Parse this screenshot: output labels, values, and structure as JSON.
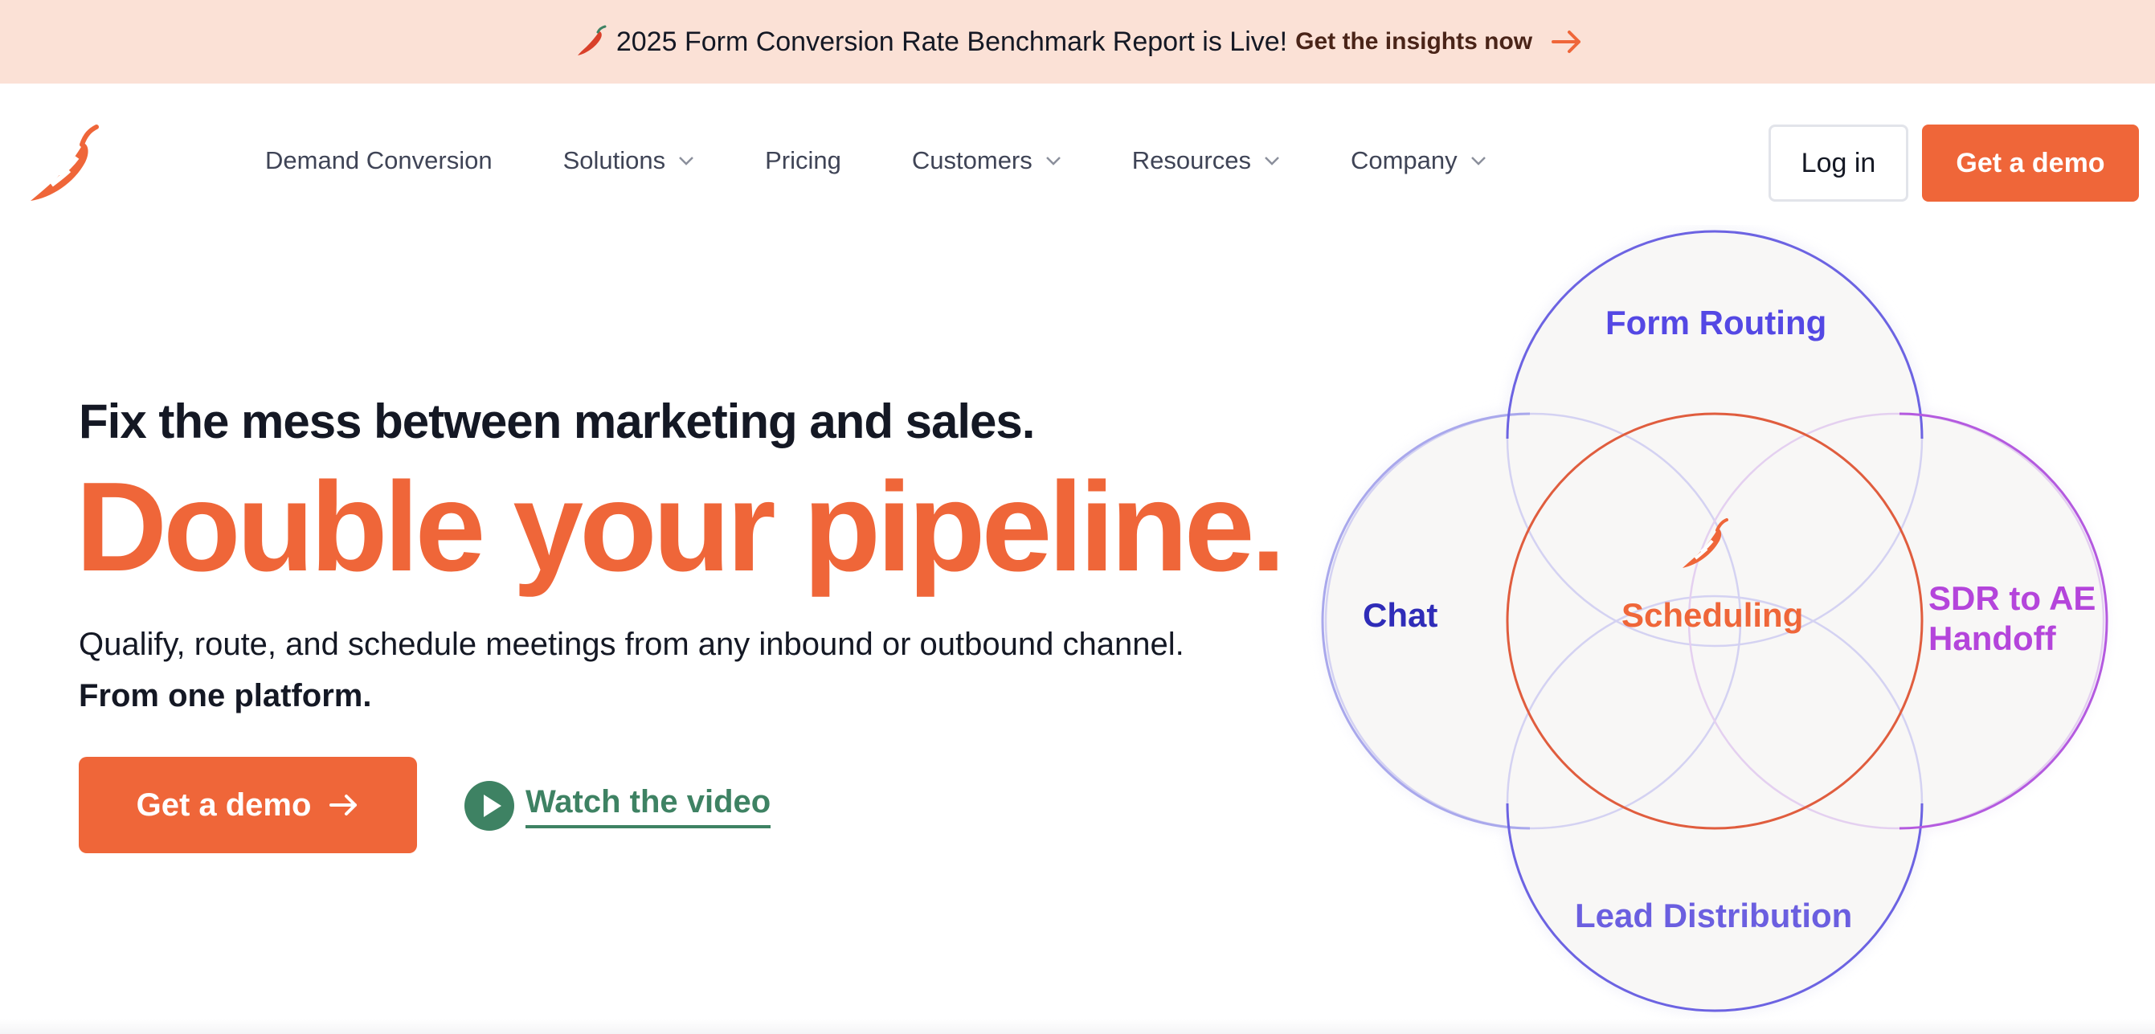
{
  "banner": {
    "message": "2025 Form Conversion Rate Benchmark Report is Live!",
    "cta": "Get the insights now"
  },
  "nav": {
    "items": [
      {
        "label": "Demand Conversion",
        "dropdown": false
      },
      {
        "label": "Solutions",
        "dropdown": true
      },
      {
        "label": "Pricing",
        "dropdown": false
      },
      {
        "label": "Customers",
        "dropdown": true
      },
      {
        "label": "Resources",
        "dropdown": true
      },
      {
        "label": "Company",
        "dropdown": true
      }
    ],
    "login": "Log in",
    "demo": "Get a demo"
  },
  "hero": {
    "eyebrow": "Fix the mess between marketing and sales.",
    "headline": "Double your pipeline.",
    "sub_text": "Qualify, route, and schedule meetings from any inbound or outbound channel.",
    "sub_bold": "From one platform.",
    "demo": "Get a demo",
    "video": "Watch the video"
  },
  "venn": {
    "top": "Form Routing",
    "left": "Chat",
    "center": "Scheduling",
    "right_line1": "SDR to AE",
    "right_line2": "Handoff",
    "bottom": "Lead Distribution"
  },
  "colors": {
    "brand_orange": "#ef6639",
    "banner_bg": "#fbe1d6",
    "green": "#3e8263",
    "indigo": "#5448e4",
    "navy": "#2f2cb8",
    "purple": "#b445db"
  },
  "icons": {
    "banner": "chili-pepper-icon",
    "logo": "chili-pepper-logo",
    "chevron": "chevron-down-icon",
    "arrow": "arrow-right-icon",
    "play": "play-icon"
  }
}
